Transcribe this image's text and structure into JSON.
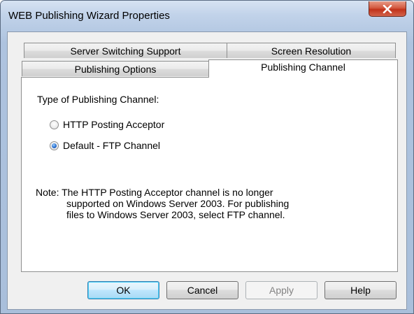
{
  "window": {
    "title": "WEB Publishing Wizard Properties"
  },
  "tabs": {
    "row_back": [
      {
        "label": "Server Switching Support"
      },
      {
        "label": "Screen Resolution"
      }
    ],
    "row_front": [
      {
        "label": "Publishing Options"
      },
      {
        "label": "Publishing Channel"
      }
    ]
  },
  "panel": {
    "heading": "Type of Publishing Channel:",
    "options": [
      {
        "label": "HTTP Posting Acceptor",
        "checked": false
      },
      {
        "label": "Default - FTP Channel",
        "checked": true
      }
    ],
    "note": {
      "line1": "Note:  The HTTP Posting Acceptor channel is no longer",
      "line2": "supported on Windows Server 2003.  For publishing",
      "line3": "files to Windows Server 2003, select FTP channel."
    }
  },
  "buttons": {
    "ok": "OK",
    "cancel": "Cancel",
    "apply": "Apply",
    "help": "Help"
  },
  "icons": {
    "close": "close-icon"
  }
}
